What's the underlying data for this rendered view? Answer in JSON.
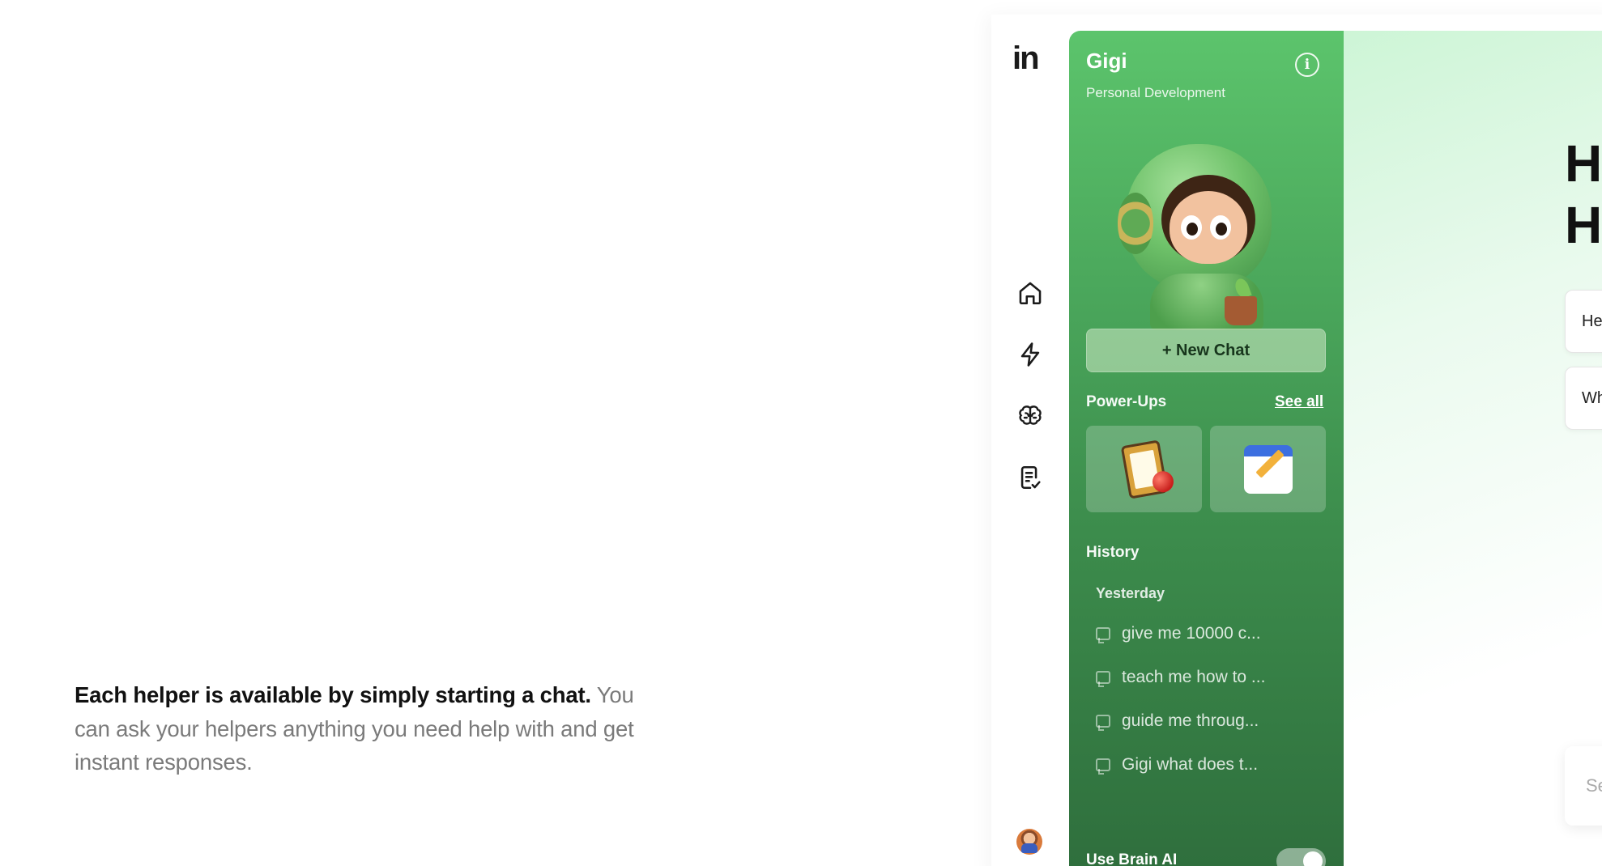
{
  "caption": {
    "strong": "Each helper is available by simply starting a chat.",
    "soft": " You can ask your helpers anything you need help with and get instant responses."
  },
  "rail": {
    "logo": "in",
    "items": [
      {
        "name": "home",
        "icon": "home-icon"
      },
      {
        "name": "power-ups",
        "icon": "lightning-icon"
      },
      {
        "name": "brain",
        "icon": "brain-icon"
      },
      {
        "name": "tasks",
        "icon": "checklist-icon"
      }
    ]
  },
  "helper": {
    "name": "Gigi",
    "category": "Personal Development",
    "info_icon": "i",
    "new_chat_label": "+ New Chat",
    "powerups_label": "Power-Ups",
    "see_all_label": "See all",
    "powerups": [
      {
        "icon": "clipboard-apple-icon"
      },
      {
        "icon": "calendar-pencil-icon"
      }
    ],
    "history_label": "History",
    "history_group": "Yesterday",
    "history": [
      "give me 10000 c...",
      "teach me how to ...",
      "guide me throug...",
      "Gigi what does t..."
    ],
    "brain_ai_label": "Use Brain AI",
    "brain_ai_enabled": true,
    "accent": "#4ba85c"
  },
  "main": {
    "greeting_line1": "He",
    "greeting_line2": "He",
    "suggestions": [
      "He",
      "Wh"
    ],
    "composer_placeholder": "Se"
  }
}
